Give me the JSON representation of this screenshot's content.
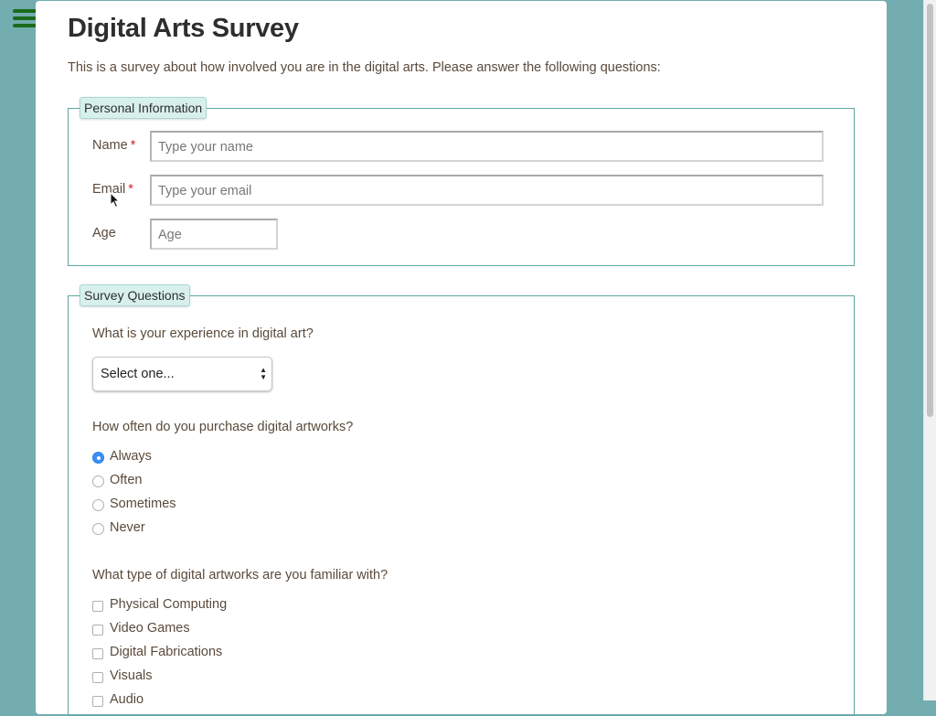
{
  "page": {
    "title": "Digital Arts Survey",
    "intro": "This is a survey about how involved you are in the digital arts. Please answer the following questions:"
  },
  "personal": {
    "legend": "Personal Information",
    "name": {
      "label": "Name",
      "required": "*",
      "placeholder": "Type your name"
    },
    "email": {
      "label": "Email",
      "required": "*",
      "placeholder": "Type your email"
    },
    "age": {
      "label": "Age",
      "placeholder": "Age"
    }
  },
  "survey": {
    "legend": "Survey Questions",
    "q1": {
      "text": "What is your experience in digital art?",
      "selected": "Select one..."
    },
    "q2": {
      "text": "How often do you purchase digital artworks?",
      "options": [
        "Always",
        "Often",
        "Sometimes",
        "Never"
      ],
      "selected": "Always"
    },
    "q3": {
      "text": "What type of digital artworks are you familiar with?",
      "options": [
        "Physical Computing",
        "Video Games",
        "Digital Fabrications",
        "Visuals",
        "Audio"
      ]
    }
  },
  "colors": {
    "background": "#73adb0",
    "accent_border": "#5ea8a0",
    "legend_bg": "#d8f0ec",
    "required": "#d0242b",
    "radio_checked": "#3b8ef3"
  },
  "icons": {
    "menu": "hamburger-menu-icon",
    "select": "select-arrows-icon",
    "cursor": "mouse-pointer-icon"
  }
}
